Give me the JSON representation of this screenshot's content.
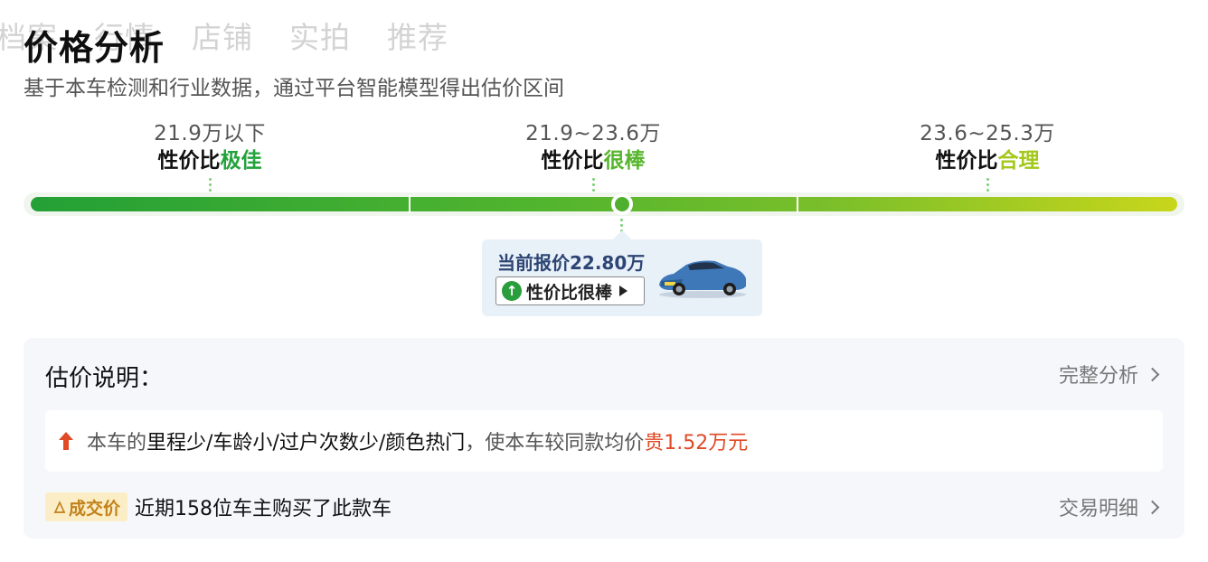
{
  "tabs": [
    "档案",
    "行情",
    "店铺",
    "实拍",
    "推荐"
  ],
  "title": "价格分析",
  "subtitle": "基于本车检测和行业数据，通过平台智能模型得出估价区间",
  "ranges": [
    {
      "price": "21.9万以下",
      "prefix": "性价比",
      "level": "极佳"
    },
    {
      "price": "21.9~23.6万",
      "prefix": "性价比",
      "level": "很棒"
    },
    {
      "price": "23.6~25.3万",
      "prefix": "性价比",
      "level": "合理"
    }
  ],
  "current": {
    "quote": "当前报价22.80万",
    "badge": "性价比很棒",
    "up_icon": "arrow-up-circle-icon"
  },
  "explain": {
    "title": "估价说明：",
    "full_analysis_link": "完整分析",
    "note_prefix": "本车的",
    "note_factors": "里程少/车龄小/过户次数少/颜色热门",
    "note_middle": "，使本车较同款均价",
    "note_amount": "贵1.52万元",
    "deal_tag": "成交价",
    "deal_text": "近期158位车主购买了此款车",
    "deal_link": "交易明细"
  },
  "colors": {
    "green_best": "#22a33c",
    "green_good": "#56b62c",
    "yellow_fair": "#a3c81a",
    "accent_red": "#e04a26",
    "quote_blue": "#2d4574"
  }
}
